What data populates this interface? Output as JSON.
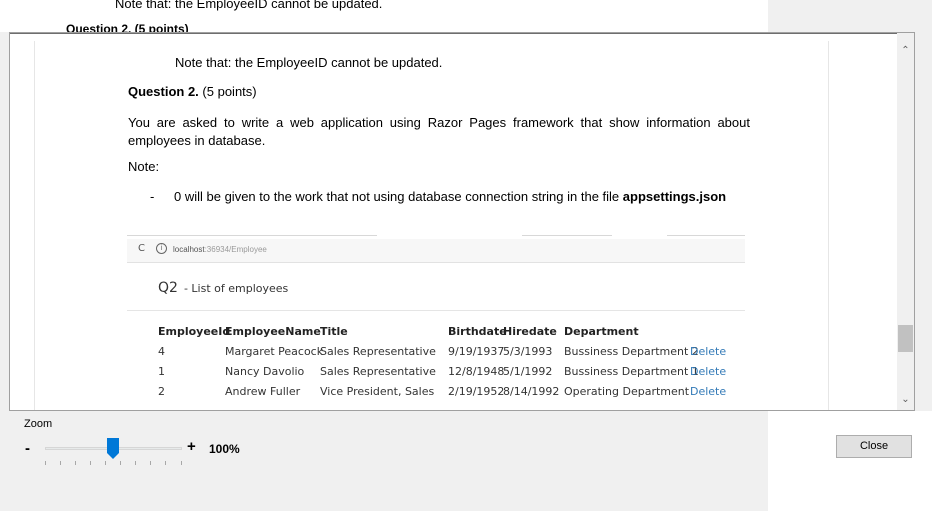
{
  "background_page": {
    "note_text": "Note that: the EmployeeID cannot be updated.",
    "question_partial": "Question 2. (5 points)"
  },
  "document": {
    "note_line": "Note that: the EmployeeID cannot be updated.",
    "question_title": "Question 2.",
    "question_points": "(5 points)",
    "paragraph": "You are asked to write a web application using Razor Pages framework that show information about employees in database.",
    "note_label": "Note:",
    "bullet_dash": "-",
    "bullet_text": "0 will be given to the work that not using database connection string in the file",
    "bullet_bold": "appsettings.json"
  },
  "embedded_browser": {
    "reload_icon": "reload-icon",
    "url_host": "localhost",
    "url_rest": ":36934/Employee",
    "page_title": "Q2",
    "page_subtitle": "- List of employees",
    "table": {
      "headers": [
        "EmployeeId",
        "EmployeeName",
        "Title",
        "Birthdate",
        "Hiredate",
        "Department"
      ],
      "rows": [
        {
          "id": "4",
          "name": "Margaret Peacock",
          "title": "Sales Representative",
          "birthdate": "9/19/1937",
          "hiredate": "5/3/1993",
          "department": "Bussiness Department 2",
          "action": "Delete"
        },
        {
          "id": "1",
          "name": "Nancy Davolio",
          "title": "Sales Representative",
          "birthdate": "12/8/1948",
          "hiredate": "5/1/1992",
          "department": "Bussiness Department 1",
          "action": "Delete"
        },
        {
          "id": "2",
          "name": "Andrew Fuller",
          "title": "Vice President, Sales",
          "birthdate": "2/19/1952",
          "hiredate": "8/14/1992",
          "department": "Operating Department",
          "action": "Delete"
        }
      ]
    }
  },
  "scrollbar": {
    "up_icon": "chevron-up-icon",
    "down_icon": "chevron-down-icon"
  },
  "zoom": {
    "label": "Zoom",
    "minus": "-",
    "plus": "+",
    "value": "100%",
    "slider_level": 0.5
  },
  "buttons": {
    "close_label": "Close"
  },
  "colors": {
    "link": "#337ab7",
    "thumb": "#0078d7"
  }
}
